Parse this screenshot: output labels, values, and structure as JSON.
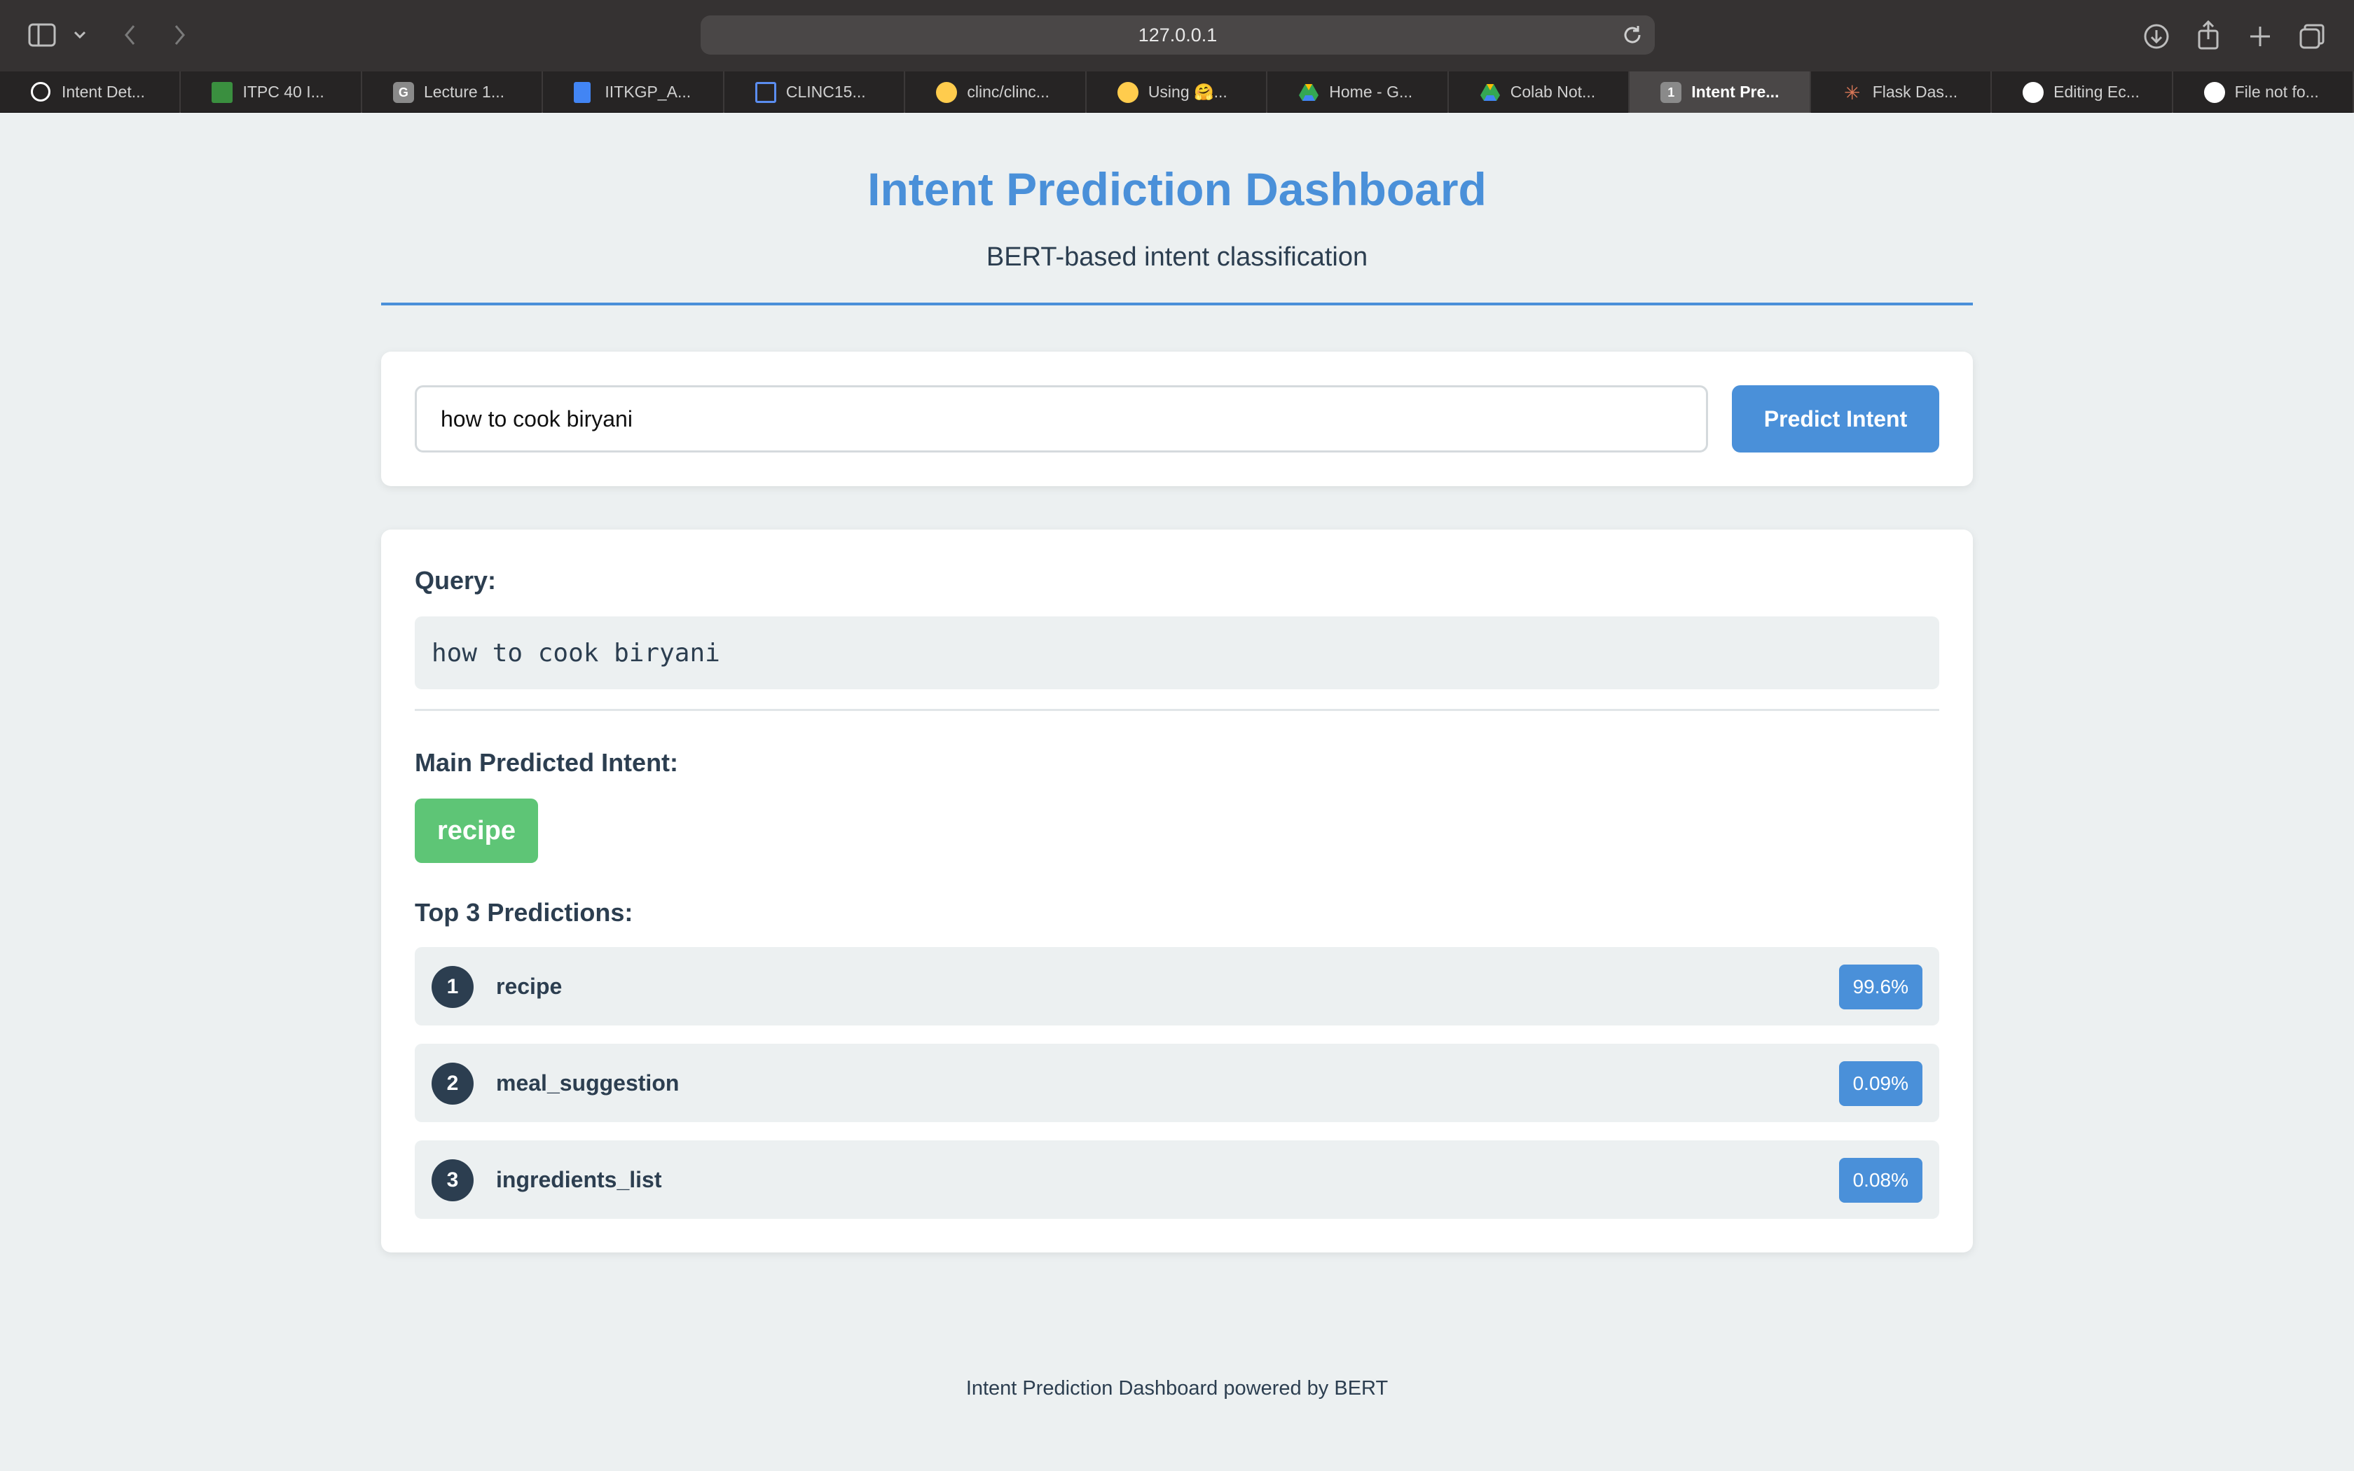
{
  "browser": {
    "url": "127.0.0.1",
    "tabs": [
      {
        "label": "Intent Det...",
        "icon": "openai-icon",
        "color": "#ffffff",
        "active": false
      },
      {
        "label": "ITPC 40 I...",
        "icon": "classroom-icon",
        "color": "#4caf50",
        "active": false
      },
      {
        "label": "Lecture 1...",
        "icon": "g-icon",
        "color": "#8a8a8a",
        "active": false
      },
      {
        "label": "IITKGP_A...",
        "icon": "docs-icon",
        "color": "#4285f4",
        "active": false
      },
      {
        "label": "CLINC15...",
        "icon": "dataset-icon",
        "color": "#5b8def",
        "active": false
      },
      {
        "label": "clinc/clinc...",
        "icon": "huggingface-icon",
        "color": "#ffcc4d",
        "active": false
      },
      {
        "label": "Using 🤗...",
        "icon": "huggingface-icon",
        "color": "#ffcc4d",
        "active": false
      },
      {
        "label": "Home - G...",
        "icon": "drive-icon",
        "color": "#34a853",
        "active": false
      },
      {
        "label": "Colab Not...",
        "icon": "drive-icon",
        "color": "#34a853",
        "active": false
      },
      {
        "label": "Intent Pre...",
        "icon": "number-1-icon",
        "color": "#8a8a8a",
        "active": true
      },
      {
        "label": "Flask Das...",
        "icon": "claude-icon",
        "color": "#d97757",
        "active": false
      },
      {
        "label": "Editing Ec...",
        "icon": "github-icon",
        "color": "#ffffff",
        "active": false
      },
      {
        "label": "File not fo...",
        "icon": "github-icon",
        "color": "#ffffff",
        "active": false
      }
    ]
  },
  "header": {
    "title": "Intent Prediction Dashboard",
    "subtitle": "BERT-based intent classification"
  },
  "form": {
    "input_value": "how to cook biryani",
    "button_label": "Predict Intent"
  },
  "results": {
    "query_label": "Query:",
    "query_text": "how to cook biryani",
    "main_label": "Main Predicted Intent:",
    "main_intent": "recipe",
    "top_label": "Top 3 Predictions:",
    "predictions": [
      {
        "rank": "1",
        "intent": "recipe",
        "score": "99.6%"
      },
      {
        "rank": "2",
        "intent": "meal_suggestion",
        "score": "0.09%"
      },
      {
        "rank": "3",
        "intent": "ingredients_list",
        "score": "0.08%"
      }
    ]
  },
  "footer": {
    "text": "Intent Prediction Dashboard powered by BERT"
  },
  "colors": {
    "accent": "#4a90d9",
    "success": "#5ec576",
    "text": "#2c3e50",
    "background": "#ecf0f1"
  }
}
